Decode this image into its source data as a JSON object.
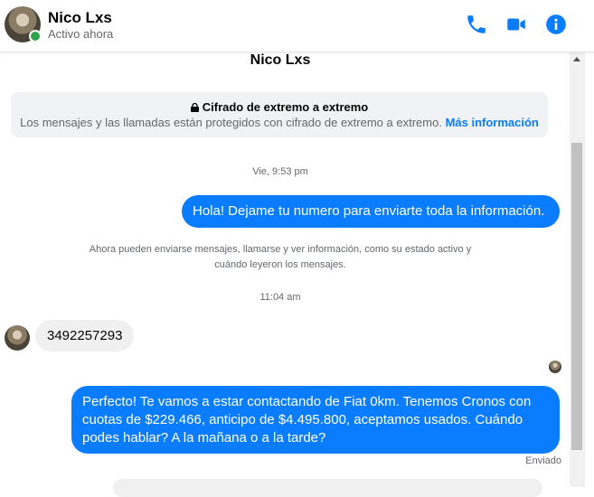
{
  "header": {
    "contact_name": "Nico Lxs",
    "status": "Activo ahora",
    "icons": [
      "phone-icon",
      "video-icon",
      "info-icon"
    ],
    "accent_color": "#0a7cff",
    "online_color": "#31a24c"
  },
  "chat_title": "Nico Lxs",
  "encryption": {
    "title": "Cifrado de extremo a extremo",
    "text": "Los mensajes y las llamadas están protegidos con cifrado de extremo a extremo.",
    "link": "Más información"
  },
  "messages": [
    {
      "type": "timestamp",
      "text": "Vie, 9:53 pm"
    },
    {
      "type": "outgoing",
      "text": "Hola! Dejame tu numero  para enviarte toda la información."
    },
    {
      "type": "system",
      "text": "Ahora pueden enviarse mensajes, llamarse y ver información, como su estado activo y cuándo leyeron los mensajes."
    },
    {
      "type": "timestamp",
      "text": "11:04 am"
    },
    {
      "type": "incoming",
      "text": "3492257293"
    },
    {
      "type": "outgoing",
      "text": "Perfecto! Te vamos a estar contactando de Fiat 0km. Tenemos Cronos con cuotas de $229.466, anticipo de $4.495.800, aceptamos usados. Cuándo podes hablar? A la mañana o a la tarde?"
    }
  ],
  "sent_status": "Enviado"
}
